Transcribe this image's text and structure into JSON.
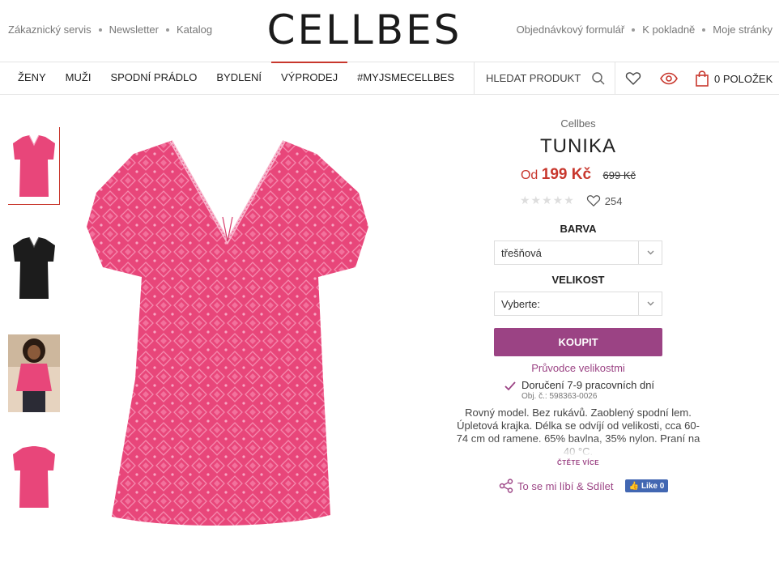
{
  "top_links_left": [
    "Zákaznický servis",
    "Newsletter",
    "Katalog"
  ],
  "top_links_right": [
    "Objednávkový formulář",
    "K pokladně",
    "Moje stránky"
  ],
  "logo": "CELLBES",
  "nav": {
    "items": [
      "ŽENY",
      "MUŽI",
      "SPODNÍ PRÁDLO",
      "BYDLENÍ",
      "VÝPRODEJ",
      "#MYJSMECELLBES"
    ],
    "active_index": 4,
    "search_label": "HLEDAT PRODUKT",
    "cart_label": "0 POLOŽEK"
  },
  "product": {
    "brand": "Cellbes",
    "title": "TUNIKA",
    "price_from": "Od",
    "price_now": "199 Kč",
    "price_old": "699 Kč",
    "stars": "★★★★★",
    "favorites_count": "254",
    "color_label": "BARVA",
    "color_value": "třešňová",
    "size_label": "VELIKOST",
    "size_value": "Vyberte:",
    "buy_label": "KOUPIT",
    "size_guide": "Průvodce velikostmi",
    "delivery": "Doručení 7-9 pracovních dní",
    "order_no": "Obj. č.: 598363-0026",
    "description": "Rovný model. Bez rukávů. Zaoblený spodní lem. Úpletová krajka. Délka se odvíjí od velikosti, cca 60-74 cm od ramene. 65% bavlna, 35% nylon. Praní na 40 °C.",
    "read_more": "ČTĚTE VÍCE",
    "share": "To se mi líbí & Sdílet",
    "fb_like": "Like 0"
  },
  "colors": {
    "accent_red": "#c8372d",
    "purple": "#9b4384",
    "garment_pink": "#e8467a",
    "facebook": "#4267b2"
  }
}
